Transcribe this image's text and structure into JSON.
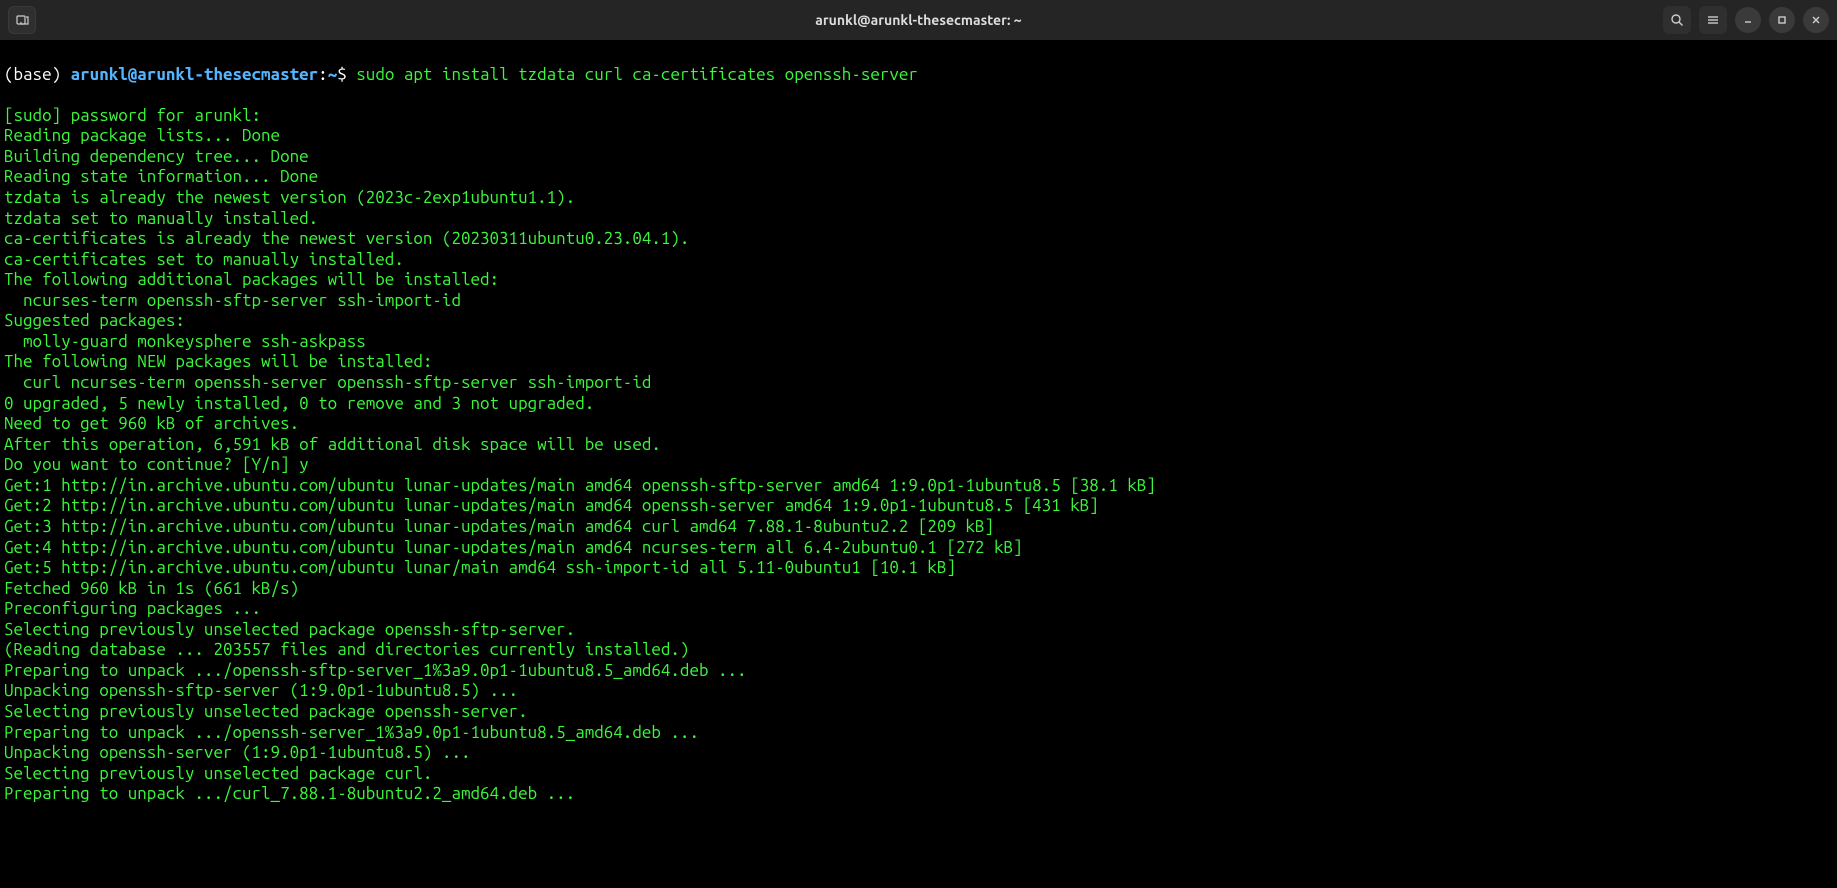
{
  "window": {
    "title": "arunkl@arunkl-thesecmaster: ~"
  },
  "prompt": {
    "env": "(base) ",
    "userhost": "arunkl@arunkl-thesecmaster",
    "separator": ":",
    "path": "~",
    "dollar": "$ ",
    "command": "sudo apt install tzdata curl ca-certificates openssh-server"
  },
  "lines": [
    "[sudo] password for arunkl:",
    "Reading package lists... Done",
    "Building dependency tree... Done",
    "Reading state information... Done",
    "tzdata is already the newest version (2023c-2exp1ubuntu1.1).",
    "tzdata set to manually installed.",
    "ca-certificates is already the newest version (20230311ubuntu0.23.04.1).",
    "ca-certificates set to manually installed.",
    "The following additional packages will be installed:",
    "  ncurses-term openssh-sftp-server ssh-import-id",
    "Suggested packages:",
    "  molly-guard monkeysphere ssh-askpass",
    "The following NEW packages will be installed:",
    "  curl ncurses-term openssh-server openssh-sftp-server ssh-import-id",
    "0 upgraded, 5 newly installed, 0 to remove and 3 not upgraded.",
    "Need to get 960 kB of archives.",
    "After this operation, 6,591 kB of additional disk space will be used.",
    "Do you want to continue? [Y/n] y",
    "Get:1 http://in.archive.ubuntu.com/ubuntu lunar-updates/main amd64 openssh-sftp-server amd64 1:9.0p1-1ubuntu8.5 [38.1 kB]",
    "Get:2 http://in.archive.ubuntu.com/ubuntu lunar-updates/main amd64 openssh-server amd64 1:9.0p1-1ubuntu8.5 [431 kB]",
    "Get:3 http://in.archive.ubuntu.com/ubuntu lunar-updates/main amd64 curl amd64 7.88.1-8ubuntu2.2 [209 kB]",
    "Get:4 http://in.archive.ubuntu.com/ubuntu lunar-updates/main amd64 ncurses-term all 6.4-2ubuntu0.1 [272 kB]",
    "Get:5 http://in.archive.ubuntu.com/ubuntu lunar/main amd64 ssh-import-id all 5.11-0ubuntu1 [10.1 kB]",
    "Fetched 960 kB in 1s (661 kB/s)",
    "Preconfiguring packages ...",
    "Selecting previously unselected package openssh-sftp-server.",
    "(Reading database ... 203557 files and directories currently installed.)",
    "Preparing to unpack .../openssh-sftp-server_1%3a9.0p1-1ubuntu8.5_amd64.deb ...",
    "Unpacking openssh-sftp-server (1:9.0p1-1ubuntu8.5) ...",
    "Selecting previously unselected package openssh-server.",
    "Preparing to unpack .../openssh-server_1%3a9.0p1-1ubuntu8.5_amd64.deb ...",
    "Unpacking openssh-server (1:9.0p1-1ubuntu8.5) ...",
    "Selecting previously unselected package curl.",
    "Preparing to unpack .../curl_7.88.1-8ubuntu2.2_amd64.deb ..."
  ]
}
